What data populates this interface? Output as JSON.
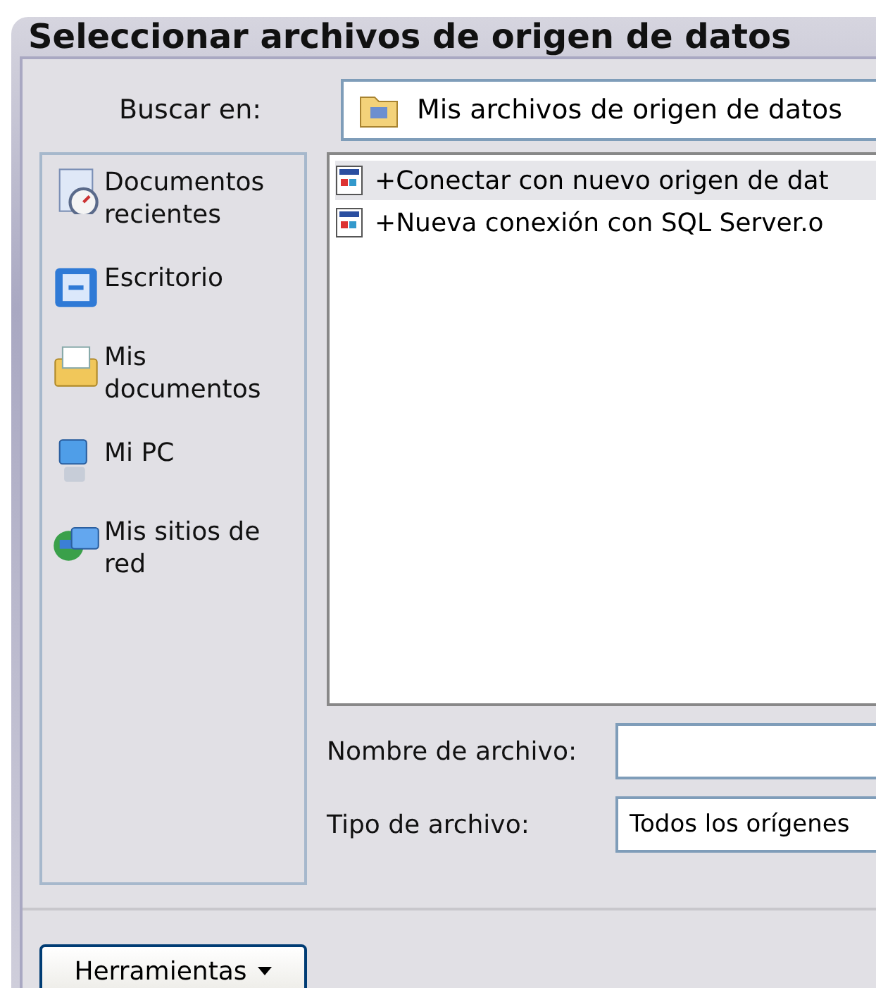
{
  "window": {
    "title": "Seleccionar archivos de origen de datos"
  },
  "look_in": {
    "label": "Buscar en:",
    "value": "Mis archivos de origen de datos"
  },
  "places": [
    {
      "label": "Documentos recientes",
      "kind": "recent"
    },
    {
      "label": "Escritorio",
      "kind": "desktop"
    },
    {
      "label": "Mis documentos",
      "kind": "documents"
    },
    {
      "label": "Mi PC",
      "kind": "computer"
    },
    {
      "label": "Mis sitios de red",
      "kind": "network"
    }
  ],
  "files": [
    {
      "name": "+Conectar con nuevo origen de dat",
      "selected": true
    },
    {
      "name": "+Nueva conexión con SQL Server.o",
      "selected": false
    }
  ],
  "file_name": {
    "label": "Nombre de archivo:"
  },
  "file_type": {
    "label": "Tipo de archivo:",
    "value": "Todos los orígenes"
  },
  "tools_button": {
    "label": "Herramientas"
  }
}
